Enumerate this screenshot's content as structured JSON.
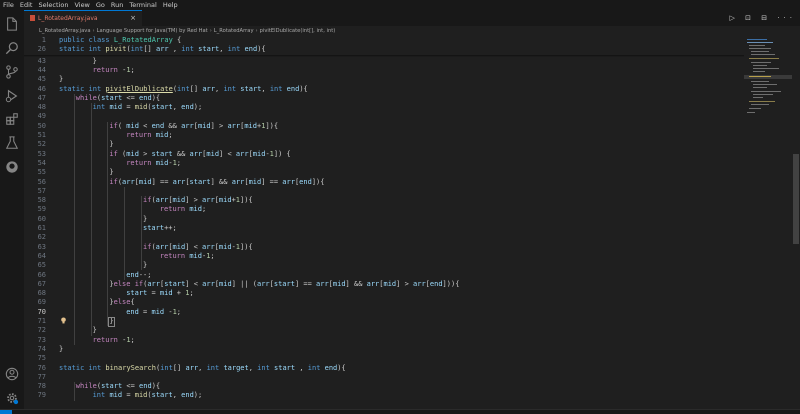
{
  "menu": [
    "File",
    "Edit",
    "Selection",
    "View",
    "Go",
    "Run",
    "Terminal",
    "Help"
  ],
  "tab": {
    "label": "L_RotatedArray.java",
    "close": "×"
  },
  "editor_actions": "▷ ⊡ ⊟ ···",
  "breadcrumb": [
    "L_RotatedArray.java",
    "Language Support for Java(TM) by Red Hat",
    "L_RotatedArray",
    "pivitElDublicate(int[], int, int)"
  ],
  "active_line": 70,
  "sticky_lines": [
    {
      "n": 1,
      "indent": 0,
      "tokens": [
        [
          "kw",
          "public "
        ],
        [
          "kw",
          "class "
        ],
        [
          "typ",
          "L_RotatedArray "
        ],
        [
          "",
          "{"
        ]
      ]
    },
    {
      "n": 26,
      "indent": 0,
      "tokens": [
        [
          "kw",
          "static "
        ],
        [
          "kw",
          "int "
        ],
        [
          "fn",
          "pivit"
        ],
        [
          "",
          "("
        ],
        [
          "kw",
          "int"
        ],
        [
          "",
          "[] "
        ],
        [
          "var",
          "arr"
        ],
        [
          "",
          " , "
        ],
        [
          "kw",
          "int "
        ],
        [
          "var",
          "start"
        ],
        [
          "",
          ", "
        ],
        [
          "kw",
          "int "
        ],
        [
          "var",
          "end"
        ],
        [
          "",
          "){"
        ]
      ]
    }
  ],
  "lines": [
    {
      "n": 43,
      "indent": 8,
      "tokens": [
        [
          "",
          "}"
        ]
      ]
    },
    {
      "n": 44,
      "indent": 8,
      "tokens": [
        [
          "ctl",
          "return "
        ],
        [
          "",
          "-"
        ],
        [
          "num",
          "1"
        ],
        [
          "",
          ";"
        ]
      ]
    },
    {
      "n": 45,
      "indent": 0,
      "tokens": [
        [
          "",
          "}"
        ]
      ]
    },
    {
      "n": 46,
      "indent": 0,
      "tokens": [
        [
          "kw",
          "static "
        ],
        [
          "kw",
          "int "
        ],
        [
          "fn u",
          "pivitElDublicate"
        ],
        [
          "",
          "("
        ],
        [
          "kw",
          "int"
        ],
        [
          "",
          "[] "
        ],
        [
          "var",
          "arr"
        ],
        [
          "",
          ", "
        ],
        [
          "kw",
          "int "
        ],
        [
          "var",
          "start"
        ],
        [
          "",
          ", "
        ],
        [
          "kw",
          "int "
        ],
        [
          "var",
          "end"
        ],
        [
          "",
          "){"
        ]
      ]
    },
    {
      "n": 47,
      "indent": 4,
      "tokens": [
        [
          "ctl",
          "while"
        ],
        [
          "",
          "("
        ],
        [
          "var",
          "start "
        ],
        [
          "",
          "<= "
        ],
        [
          "var",
          "end"
        ],
        [
          "",
          "){"
        ]
      ]
    },
    {
      "n": 48,
      "indent": 8,
      "tokens": [
        [
          "kw",
          "int "
        ],
        [
          "var",
          "mid "
        ],
        [
          "",
          "= "
        ],
        [
          "fn",
          "mid"
        ],
        [
          "",
          "("
        ],
        [
          "var",
          "start"
        ],
        [
          "",
          ", "
        ],
        [
          "var",
          "end"
        ],
        [
          "",
          ");"
        ]
      ]
    },
    {
      "n": 49,
      "indent": 0,
      "tokens": []
    },
    {
      "n": 50,
      "indent": 12,
      "tokens": [
        [
          "ctl",
          "if"
        ],
        [
          "",
          "( "
        ],
        [
          "var",
          "mid "
        ],
        [
          "",
          "< "
        ],
        [
          "var",
          "end "
        ],
        [
          "",
          "&& "
        ],
        [
          "var",
          "arr"
        ],
        [
          "",
          "["
        ],
        [
          "var",
          "mid"
        ],
        [
          "",
          "] > "
        ],
        [
          "var",
          "arr"
        ],
        [
          "",
          "["
        ],
        [
          "var",
          "mid"
        ],
        [
          "",
          "+"
        ],
        [
          "num",
          "1"
        ],
        [
          "",
          "]){"
        ]
      ]
    },
    {
      "n": 51,
      "indent": 16,
      "tokens": [
        [
          "ctl",
          "return "
        ],
        [
          "var",
          "mid"
        ],
        [
          "",
          ";"
        ]
      ]
    },
    {
      "n": 52,
      "indent": 12,
      "tokens": [
        [
          "",
          "}"
        ]
      ]
    },
    {
      "n": 53,
      "indent": 12,
      "tokens": [
        [
          "ctl",
          "if "
        ],
        [
          "",
          "("
        ],
        [
          "var",
          "mid "
        ],
        [
          "",
          "> "
        ],
        [
          "var",
          "start "
        ],
        [
          "",
          "&& "
        ],
        [
          "var",
          "arr"
        ],
        [
          "",
          "["
        ],
        [
          "var",
          "mid"
        ],
        [
          "",
          "] < "
        ],
        [
          "var",
          "arr"
        ],
        [
          "",
          "["
        ],
        [
          "var",
          "mid"
        ],
        [
          "",
          "-"
        ],
        [
          "num",
          "1"
        ],
        [
          "",
          "]) {"
        ]
      ]
    },
    {
      "n": 54,
      "indent": 16,
      "tokens": [
        [
          "ctl",
          "return "
        ],
        [
          "var",
          "mid"
        ],
        [
          "",
          "-"
        ],
        [
          "num",
          "1"
        ],
        [
          "",
          ";"
        ]
      ]
    },
    {
      "n": 55,
      "indent": 12,
      "tokens": [
        [
          "",
          "}"
        ]
      ]
    },
    {
      "n": 56,
      "indent": 12,
      "tokens": [
        [
          "ctl",
          "if"
        ],
        [
          "",
          "("
        ],
        [
          "var",
          "arr"
        ],
        [
          "",
          "["
        ],
        [
          "var",
          "mid"
        ],
        [
          "",
          "] == "
        ],
        [
          "var",
          "arr"
        ],
        [
          "",
          "["
        ],
        [
          "var",
          "start"
        ],
        [
          "",
          "] && "
        ],
        [
          "var",
          "arr"
        ],
        [
          "",
          "["
        ],
        [
          "var",
          "mid"
        ],
        [
          "",
          "] == "
        ],
        [
          "var",
          "arr"
        ],
        [
          "",
          "["
        ],
        [
          "var",
          "end"
        ],
        [
          "",
          "]){"
        ]
      ]
    },
    {
      "n": 57,
      "indent": 0,
      "tokens": []
    },
    {
      "n": 58,
      "indent": 20,
      "tokens": [
        [
          "ctl",
          "if"
        ],
        [
          "",
          "("
        ],
        [
          "var",
          "arr"
        ],
        [
          "",
          "["
        ],
        [
          "var",
          "mid"
        ],
        [
          "",
          "] > "
        ],
        [
          "var",
          "arr"
        ],
        [
          "",
          "["
        ],
        [
          "var",
          "mid"
        ],
        [
          "",
          "+"
        ],
        [
          "num",
          "1"
        ],
        [
          "",
          "]){"
        ]
      ]
    },
    {
      "n": 59,
      "indent": 24,
      "tokens": [
        [
          "ctl",
          "return "
        ],
        [
          "var",
          "mid"
        ],
        [
          "",
          ";"
        ]
      ]
    },
    {
      "n": 60,
      "indent": 20,
      "tokens": [
        [
          "",
          "}"
        ]
      ]
    },
    {
      "n": 61,
      "indent": 20,
      "tokens": [
        [
          "var",
          "start"
        ],
        [
          "",
          "++;"
        ]
      ]
    },
    {
      "n": 62,
      "indent": 0,
      "tokens": []
    },
    {
      "n": 63,
      "indent": 20,
      "tokens": [
        [
          "ctl",
          "if"
        ],
        [
          "",
          "("
        ],
        [
          "var",
          "arr"
        ],
        [
          "",
          "["
        ],
        [
          "var",
          "mid"
        ],
        [
          "",
          "] < "
        ],
        [
          "var",
          "arr"
        ],
        [
          "",
          "["
        ],
        [
          "var",
          "mid"
        ],
        [
          "",
          "-"
        ],
        [
          "num",
          "1"
        ],
        [
          "",
          "]){"
        ]
      ]
    },
    {
      "n": 64,
      "indent": 24,
      "tokens": [
        [
          "ctl",
          "return "
        ],
        [
          "var",
          "mid"
        ],
        [
          "",
          "-"
        ],
        [
          "num",
          "1"
        ],
        [
          "",
          ";"
        ]
      ]
    },
    {
      "n": 65,
      "indent": 20,
      "tokens": [
        [
          "",
          "}"
        ]
      ]
    },
    {
      "n": 66,
      "indent": 16,
      "tokens": [
        [
          "var",
          "end"
        ],
        [
          "",
          "--;"
        ]
      ]
    },
    {
      "n": 67,
      "indent": 12,
      "tokens": [
        [
          "",
          "}"
        ],
        [
          "ctl",
          "else "
        ],
        [
          "ctl",
          "if"
        ],
        [
          "",
          "("
        ],
        [
          "var",
          "arr"
        ],
        [
          "",
          "["
        ],
        [
          "var",
          "start"
        ],
        [
          "",
          "] < "
        ],
        [
          "var",
          "arr"
        ],
        [
          "",
          "["
        ],
        [
          "var",
          "mid"
        ],
        [
          "",
          "] || ("
        ],
        [
          "var",
          "arr"
        ],
        [
          "",
          "["
        ],
        [
          "var",
          "start"
        ],
        [
          "",
          "] == "
        ],
        [
          "var",
          "arr"
        ],
        [
          "",
          "["
        ],
        [
          "var",
          "mid"
        ],
        [
          "",
          "] && "
        ],
        [
          "var",
          "arr"
        ],
        [
          "",
          "["
        ],
        [
          "var",
          "mid"
        ],
        [
          "",
          "] > "
        ],
        [
          "var",
          "arr"
        ],
        [
          "",
          "["
        ],
        [
          "var",
          "end"
        ],
        [
          "",
          "])){"
        ]
      ]
    },
    {
      "n": 68,
      "indent": 16,
      "tokens": [
        [
          "var",
          "start "
        ],
        [
          "",
          "= "
        ],
        [
          "var",
          "mid "
        ],
        [
          "",
          "+ "
        ],
        [
          "num",
          "1"
        ],
        [
          "",
          ";"
        ]
      ]
    },
    {
      "n": 69,
      "indent": 12,
      "tokens": [
        [
          "",
          "}"
        ],
        [
          "ctl",
          "else"
        ],
        [
          "",
          "{"
        ]
      ]
    },
    {
      "n": 70,
      "indent": 16,
      "tokens": [
        [
          "var",
          "end "
        ],
        [
          "",
          "= "
        ],
        [
          "var",
          "mid "
        ],
        [
          "",
          "-"
        ],
        [
          "num",
          "1"
        ],
        [
          "",
          ";"
        ]
      ]
    },
    {
      "n": 71,
      "indent": 12,
      "tokens": [
        [
          "",
          "}"
        ]
      ]
    },
    {
      "n": 72,
      "indent": 8,
      "tokens": [
        [
          "",
          "}"
        ]
      ]
    },
    {
      "n": 73,
      "indent": 8,
      "tokens": [
        [
          "ctl",
          "return "
        ],
        [
          "",
          "-"
        ],
        [
          "num",
          "1"
        ],
        [
          "",
          ";"
        ]
      ]
    },
    {
      "n": 74,
      "indent": 0,
      "tokens": [
        [
          "",
          "}"
        ]
      ]
    },
    {
      "n": 75,
      "indent": 0,
      "tokens": []
    },
    {
      "n": 76,
      "indent": 0,
      "tokens": [
        [
          "kw",
          "static "
        ],
        [
          "kw",
          "int "
        ],
        [
          "fn",
          "binarySearch"
        ],
        [
          "",
          "("
        ],
        [
          "kw",
          "int"
        ],
        [
          "",
          "[] "
        ],
        [
          "var",
          "arr"
        ],
        [
          "",
          ", "
        ],
        [
          "kw",
          "int "
        ],
        [
          "var",
          "target"
        ],
        [
          "",
          ", "
        ],
        [
          "kw",
          "int "
        ],
        [
          "var",
          "start "
        ],
        [
          "",
          ", "
        ],
        [
          "kw",
          "int "
        ],
        [
          "var",
          "end"
        ],
        [
          "",
          "){"
        ]
      ]
    },
    {
      "n": 77,
      "indent": 0,
      "tokens": []
    },
    {
      "n": 78,
      "indent": 4,
      "tokens": [
        [
          "ctl",
          "while"
        ],
        [
          "",
          "("
        ],
        [
          "var",
          "start "
        ],
        [
          "",
          "<= "
        ],
        [
          "var",
          "end"
        ],
        [
          "",
          "){"
        ]
      ]
    },
    {
      "n": 79,
      "indent": 8,
      "tokens": [
        [
          "kw",
          "int "
        ],
        [
          "var",
          "mid "
        ],
        [
          "",
          "= "
        ],
        [
          "fn",
          "mid"
        ],
        [
          "",
          "("
        ],
        [
          "var",
          "start"
        ],
        [
          "",
          ", "
        ],
        [
          "var",
          "end"
        ],
        [
          "",
          ");"
        ]
      ]
    }
  ],
  "colors": {
    "accent": "#0078d4",
    "background": "#1f1f1f",
    "keyword": "#569cd6",
    "control": "#c586c0",
    "function": "#dcdcaa",
    "variable": "#9cdcfe",
    "number": "#b5cea8",
    "type": "#4ec9b0"
  },
  "activity_icons": [
    "explorer-icon",
    "search-icon",
    "source-control-icon",
    "run-debug-icon",
    "extensions-icon",
    "testing-icon",
    "github-icon",
    "account-icon",
    "settings-gear-icon"
  ]
}
